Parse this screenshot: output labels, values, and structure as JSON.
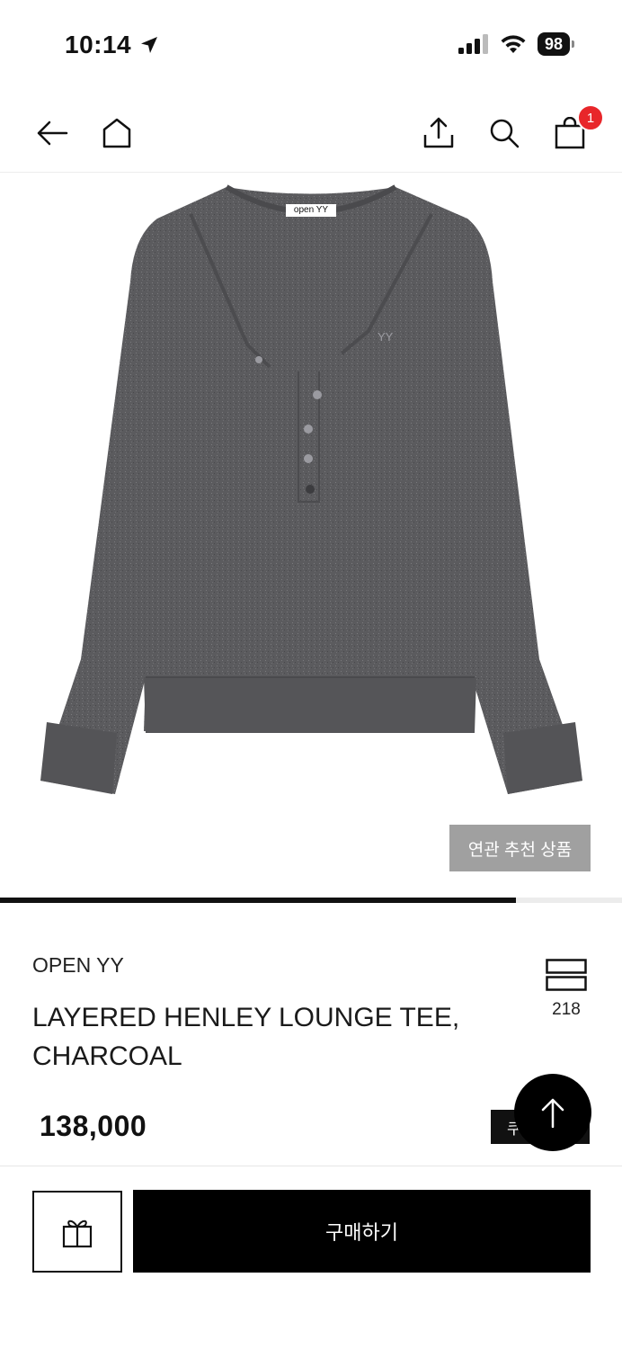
{
  "status_bar": {
    "time": "10:14",
    "battery": "98"
  },
  "nav": {
    "cart_count": "1",
    "icons": [
      "back-arrow-icon",
      "home-icon",
      "share-icon",
      "search-icon",
      "cart-icon"
    ]
  },
  "product_image": {
    "garment_label": "open YY",
    "logo": "YY",
    "related_button": "연관 추천 상품"
  },
  "gallery_progress": 0.83,
  "product": {
    "brand": "OPEN YY",
    "name": "LAYERED HENLEY LOUNGE TEE, CHARCOAL",
    "compare_count": "218",
    "price": "138,000",
    "coupon_label": "쿠"
  },
  "bottom_bar": {
    "buy_label": "구매하기"
  },
  "colors": {
    "accent": "#000000",
    "badge": "#e8262a",
    "garment": "#5b5b5e",
    "related_button_bg": "#a0a0a0"
  }
}
